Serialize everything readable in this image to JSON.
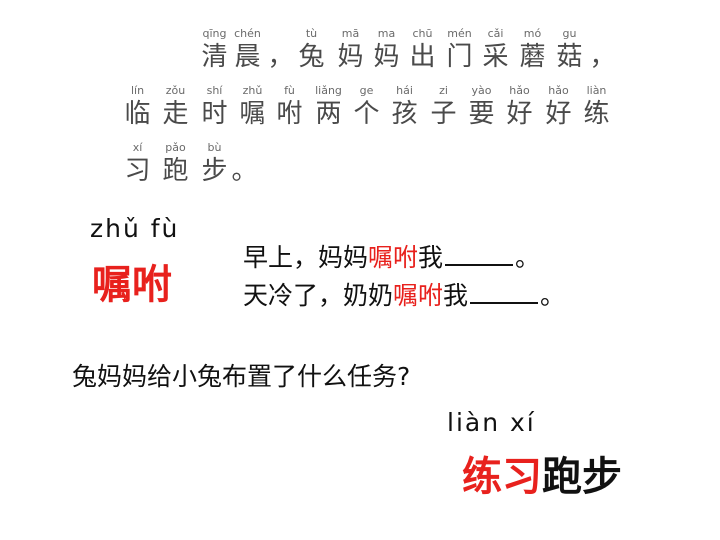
{
  "passage": {
    "lines": [
      {
        "pinyin": [
          "qīng",
          "chén",
          "",
          "tù",
          "mā",
          "ma",
          "chū",
          "mén",
          "cǎi",
          "mó",
          "gu",
          ""
        ],
        "hanzi": [
          "清",
          "晨",
          "，",
          "兔",
          "妈",
          "妈",
          "出",
          "门",
          "采",
          "蘑",
          "菇",
          "，"
        ]
      },
      {
        "pinyin": [
          "lín",
          "zǒu",
          "shí",
          "zhǔ",
          "fù",
          "liǎng",
          "ge",
          "hái",
          "zi",
          "yào",
          "hǎo",
          "hǎo",
          "liàn"
        ],
        "hanzi": [
          "临",
          "走",
          "时",
          "嘱",
          "咐",
          "两",
          "个",
          "孩",
          "子",
          "要",
          "好",
          "好",
          "练"
        ]
      },
      {
        "pinyin": [
          "xí",
          "pǎo",
          "bù",
          ""
        ],
        "hanzi": [
          "习",
          "跑",
          "步",
          "。"
        ]
      }
    ]
  },
  "vocab": {
    "pinyin": "zhǔ fù",
    "word": "嘱咐"
  },
  "sentences": [
    {
      "before": "早上，妈妈",
      "highlight": "嘱咐",
      "after": "我",
      "end": "。"
    },
    {
      "before": "天冷了，奶奶",
      "highlight": "嘱咐",
      "after": "我",
      "end": "。"
    }
  ],
  "question": "兔妈妈给小兔布置了什么任务?",
  "answer": {
    "pinyin": "liàn xí",
    "red": "练习",
    "black": "跑步"
  },
  "colors": {
    "highlight": "#e8211d",
    "text": "#111111",
    "passage_text": "#4a4a4a"
  }
}
